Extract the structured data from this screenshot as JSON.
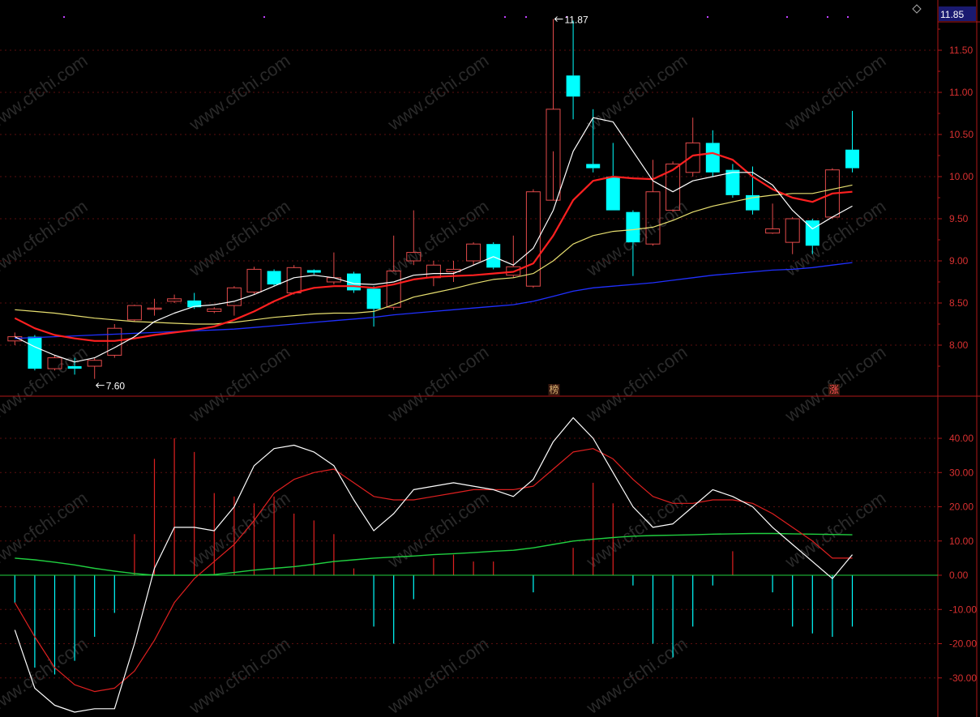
{
  "colors": {
    "background": "#000000",
    "axis_line": "#b01818",
    "axis_text": "#d83030",
    "up_candle": "#e24a4a",
    "down_candle": "#00ffff",
    "ma5": "#ffffff",
    "ma10": "#ff2020",
    "ma20": "#e8e070",
    "ma60": "#2030ff",
    "osc_fast": "#ffffff",
    "osc_slow": "#e02020",
    "osc_base": "#20d040",
    "marker_purple": "#c040ff",
    "current_price_label_bg": "#1a1a70"
  },
  "watermark": "www.cfchi.com",
  "top_right_icon": "diamond-icon",
  "current_price_label": "11.85",
  "annotations": {
    "high": "11.87",
    "low": "7.60",
    "badge_bang": "榜",
    "badge_zhang": "涨"
  },
  "chart_data": [
    {
      "type": "candlestick",
      "title": "",
      "xlabel": "",
      "ylabel": "",
      "ylim": [
        7.45,
        11.95
      ],
      "y_ticks": [
        "11.50",
        "11.00",
        "10.50",
        "10.00",
        "9.50",
        "9.00",
        "8.50",
        "8.00"
      ],
      "y_tick_values": [
        11.5,
        11.0,
        10.5,
        10.0,
        9.5,
        9.0,
        8.5,
        8.0
      ],
      "grid": true,
      "candles": [
        {
          "o": 8.05,
          "c": 8.1,
          "h": 8.15,
          "l": 8.0
        },
        {
          "o": 8.1,
          "c": 7.72,
          "h": 8.12,
          "l": 7.7
        },
        {
          "o": 7.72,
          "c": 7.85,
          "h": 7.88,
          "l": 7.7
        },
        {
          "o": 7.75,
          "c": 7.72,
          "h": 7.85,
          "l": 7.65
        },
        {
          "o": 7.75,
          "c": 7.82,
          "h": 7.85,
          "l": 7.6
        },
        {
          "o": 7.88,
          "c": 8.2,
          "h": 8.25,
          "l": 7.85
        },
        {
          "o": 8.3,
          "c": 8.47,
          "h": 8.48,
          "l": 8.28
        },
        {
          "o": 8.43,
          "c": 8.44,
          "h": 8.55,
          "l": 8.35
        },
        {
          "o": 8.52,
          "c": 8.55,
          "h": 8.6,
          "l": 8.5
        },
        {
          "o": 8.53,
          "c": 8.45,
          "h": 8.62,
          "l": 8.43
        },
        {
          "o": 8.4,
          "c": 8.43,
          "h": 8.45,
          "l": 8.38
        },
        {
          "o": 8.47,
          "c": 8.68,
          "h": 8.7,
          "l": 8.35
        },
        {
          "o": 8.63,
          "c": 8.9,
          "h": 8.93,
          "l": 8.6
        },
        {
          "o": 8.88,
          "c": 8.72,
          "h": 8.9,
          "l": 8.7
        },
        {
          "o": 8.62,
          "c": 8.92,
          "h": 8.95,
          "l": 8.6
        },
        {
          "o": 8.89,
          "c": 8.86,
          "h": 8.9,
          "l": 8.84
        },
        {
          "o": 8.75,
          "c": 8.8,
          "h": 9.1,
          "l": 8.72
        },
        {
          "o": 8.85,
          "c": 8.65,
          "h": 8.87,
          "l": 8.62
        },
        {
          "o": 8.67,
          "c": 8.43,
          "h": 8.7,
          "l": 8.22
        },
        {
          "o": 8.45,
          "c": 8.88,
          "h": 9.3,
          "l": 8.42
        },
        {
          "o": 9.0,
          "c": 9.1,
          "h": 9.6,
          "l": 8.95
        },
        {
          "o": 8.8,
          "c": 8.95,
          "h": 9.0,
          "l": 8.7
        },
        {
          "o": 8.87,
          "c": 8.9,
          "h": 9.0,
          "l": 8.75
        },
        {
          "o": 9.0,
          "c": 9.2,
          "h": 9.22,
          "l": 8.95
        },
        {
          "o": 9.2,
          "c": 8.92,
          "h": 9.22,
          "l": 8.9
        },
        {
          "o": 8.83,
          "c": 8.93,
          "h": 9.3,
          "l": 8.8
        },
        {
          "o": 8.7,
          "c": 9.82,
          "h": 9.85,
          "l": 8.68
        },
        {
          "o": 9.72,
          "c": 10.8,
          "h": 11.87,
          "l": 10.3
        },
        {
          "o": 11.2,
          "c": 10.95,
          "h": 11.85,
          "l": 10.68
        },
        {
          "o": 10.15,
          "c": 10.1,
          "h": 10.8,
          "l": 10.05
        },
        {
          "o": 10.0,
          "c": 9.6,
          "h": 10.4,
          "l": 9.6
        },
        {
          "o": 9.58,
          "c": 9.22,
          "h": 9.6,
          "l": 8.82
        },
        {
          "o": 9.2,
          "c": 9.82,
          "h": 10.2,
          "l": 9.18
        },
        {
          "o": 9.6,
          "c": 10.15,
          "h": 10.18,
          "l": 9.58
        },
        {
          "o": 10.05,
          "c": 10.4,
          "h": 10.7,
          "l": 10.0
        },
        {
          "o": 10.4,
          "c": 10.05,
          "h": 10.55,
          "l": 10.0
        },
        {
          "o": 10.08,
          "c": 9.78,
          "h": 10.15,
          "l": 9.75
        },
        {
          "o": 9.78,
          "c": 9.6,
          "h": 10.12,
          "l": 9.55
        },
        {
          "o": 9.33,
          "c": 9.38,
          "h": 9.68,
          "l": 9.32
        },
        {
          "o": 9.22,
          "c": 9.5,
          "h": 9.52,
          "l": 9.08
        },
        {
          "o": 9.48,
          "c": 9.18,
          "h": 9.5,
          "l": 9.08
        },
        {
          "o": 9.52,
          "c": 10.08,
          "h": 10.1,
          "l": 9.5
        },
        {
          "o": 10.32,
          "c": 10.1,
          "h": 10.78,
          "l": 10.05
        }
      ],
      "ma5": [
        8.1,
        7.98,
        7.88,
        7.8,
        7.85,
        7.97,
        8.1,
        8.28,
        8.38,
        8.46,
        8.48,
        8.52,
        8.6,
        8.7,
        8.8,
        8.83,
        8.8,
        8.73,
        8.72,
        8.75,
        8.83,
        8.85,
        8.85,
        8.95,
        9.05,
        8.95,
        9.15,
        9.6,
        10.3,
        10.7,
        10.65,
        10.3,
        9.95,
        9.82,
        9.95,
        10.0,
        10.05,
        10.05,
        9.9,
        9.6,
        9.38,
        9.52,
        9.65
      ],
      "ma10": [
        8.32,
        8.2,
        8.12,
        8.08,
        8.05,
        8.05,
        8.08,
        8.12,
        8.15,
        8.18,
        8.22,
        8.3,
        8.4,
        8.52,
        8.62,
        8.68,
        8.7,
        8.7,
        8.68,
        8.72,
        8.78,
        8.81,
        8.82,
        8.83,
        8.85,
        8.87,
        8.97,
        9.3,
        9.72,
        9.95,
        10.0,
        9.98,
        9.97,
        10.08,
        10.25,
        10.28,
        10.2,
        10.0,
        9.85,
        9.75,
        9.7,
        9.8,
        9.82
      ],
      "ma20": [
        8.42,
        8.4,
        8.38,
        8.35,
        8.32,
        8.3,
        8.28,
        8.27,
        8.26,
        8.25,
        8.25,
        8.27,
        8.3,
        8.33,
        8.35,
        8.37,
        8.38,
        8.38,
        8.4,
        8.48,
        8.57,
        8.62,
        8.67,
        8.73,
        8.78,
        8.8,
        8.85,
        9.0,
        9.2,
        9.3,
        9.35,
        9.37,
        9.4,
        9.48,
        9.58,
        9.65,
        9.7,
        9.75,
        9.78,
        9.8,
        9.8,
        9.85,
        9.9
      ],
      "ma60": [
        8.08,
        8.09,
        8.1,
        8.11,
        8.12,
        8.13,
        8.14,
        8.15,
        8.16,
        8.17,
        8.18,
        8.19,
        8.21,
        8.23,
        8.25,
        8.27,
        8.29,
        8.31,
        8.33,
        8.36,
        8.38,
        8.4,
        8.42,
        8.44,
        8.46,
        8.48,
        8.52,
        8.58,
        8.64,
        8.68,
        8.7,
        8.72,
        8.74,
        8.77,
        8.8,
        8.83,
        8.85,
        8.87,
        8.89,
        8.9,
        8.92,
        8.95,
        8.98
      ]
    },
    {
      "type": "bar",
      "title": "",
      "xlabel": "",
      "ylabel": "",
      "ylim": [
        -41,
        50
      ],
      "y_ticks": [
        "40.00",
        "30.00",
        "20.00",
        "10.00",
        "0.00",
        "-10.00",
        "-20.00",
        "-30.00"
      ],
      "y_tick_values": [
        40,
        30,
        20,
        10,
        0,
        -10,
        -20,
        -30
      ],
      "histogram": [
        -8,
        -27,
        -29,
        -25,
        -18,
        -11,
        12,
        34,
        40,
        36,
        24,
        23,
        21,
        23,
        18,
        16,
        12,
        2,
        -15,
        -20,
        -7,
        5,
        6,
        4,
        4,
        0,
        -5,
        0,
        8,
        27,
        21,
        -3,
        -20,
        -24,
        -15,
        -3,
        7,
        0,
        -5,
        -15,
        -17,
        -18,
        -15
      ],
      "fast_line": [
        -16,
        -33,
        -38,
        -40,
        -39,
        -39,
        -20,
        2,
        14,
        14,
        13,
        20,
        32,
        37,
        38,
        36,
        32,
        22,
        13,
        18,
        25,
        26,
        27,
        26,
        25,
        23,
        28,
        39,
        46,
        40,
        30,
        20,
        14,
        15,
        20,
        25,
        23,
        20,
        14,
        9,
        4,
        -1,
        6
      ],
      "slow_line": [
        -8,
        -18,
        -27,
        -32,
        -34,
        -33,
        -28,
        -19,
        -8,
        -1,
        4,
        9,
        16,
        24,
        28,
        30,
        31,
        27,
        23,
        22,
        22,
        23,
        24,
        25,
        25,
        25,
        26,
        31,
        36,
        37,
        34,
        28,
        23,
        21,
        21,
        22,
        22,
        21,
        18,
        14,
        10,
        5,
        5
      ],
      "base_line": [
        5,
        4.5,
        3.8,
        3,
        2,
        1.2,
        0.5,
        0,
        0,
        0,
        0.2,
        0.8,
        1.5,
        2,
        2.5,
        3.2,
        4,
        4.5,
        5,
        5.3,
        5.6,
        6,
        6.3,
        6.6,
        7,
        7.3,
        8,
        9,
        10,
        10.5,
        11,
        11.4,
        11.6,
        11.7,
        11.8,
        12,
        12.1,
        12.2,
        12.2,
        12.1,
        12,
        11.9,
        11.8
      ]
    }
  ]
}
